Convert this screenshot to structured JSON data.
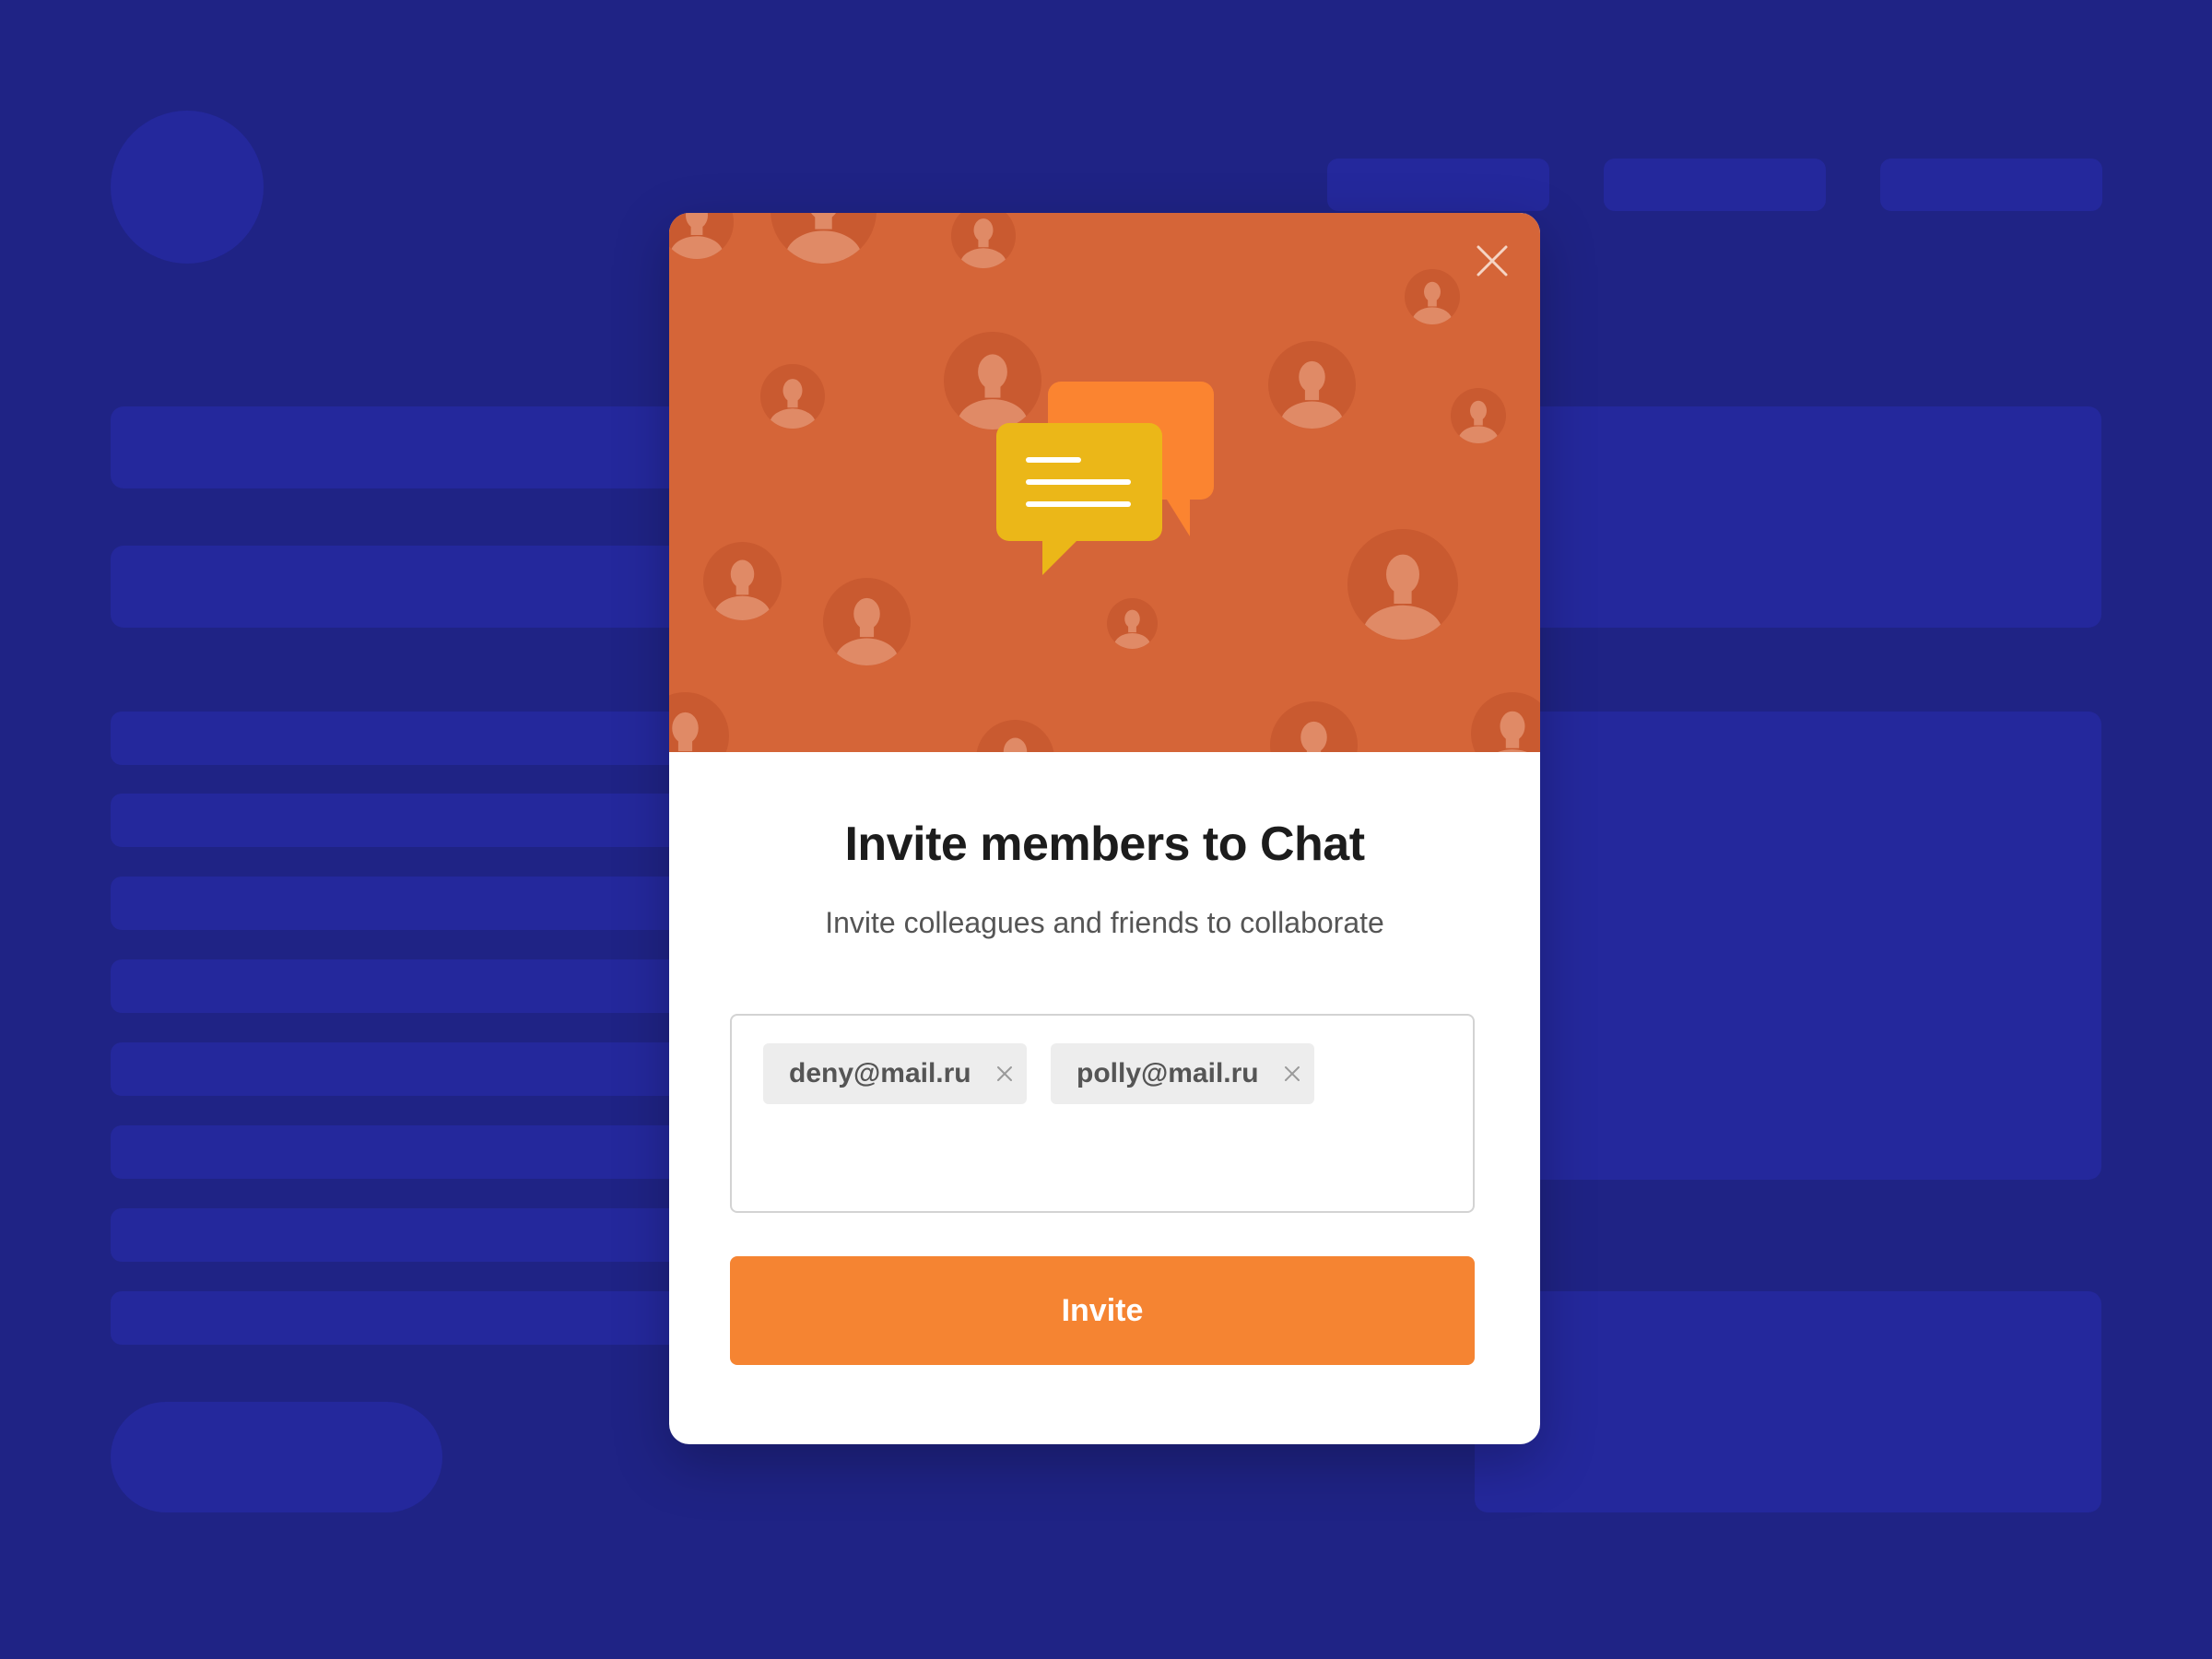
{
  "colors": {
    "page_background": "#1f2385",
    "placeholder": "#24289c",
    "hero_background": "#d56538",
    "accent": "#f58432",
    "chat_bubble_front": "#ebb718",
    "chat_bubble_back": "#fb8430"
  },
  "modal": {
    "title": "Invite members to Chat",
    "subtitle": "Invite colleagues and friends to collaborate",
    "close_icon": "close-icon",
    "hero_icon": "chat-bubbles-icon",
    "emails": [
      {
        "value": "deny@mail.ru",
        "remove_icon": "remove-icon"
      },
      {
        "value": "polly@mail.ru",
        "remove_icon": "remove-icon"
      }
    ],
    "invite_label": "Invite"
  }
}
